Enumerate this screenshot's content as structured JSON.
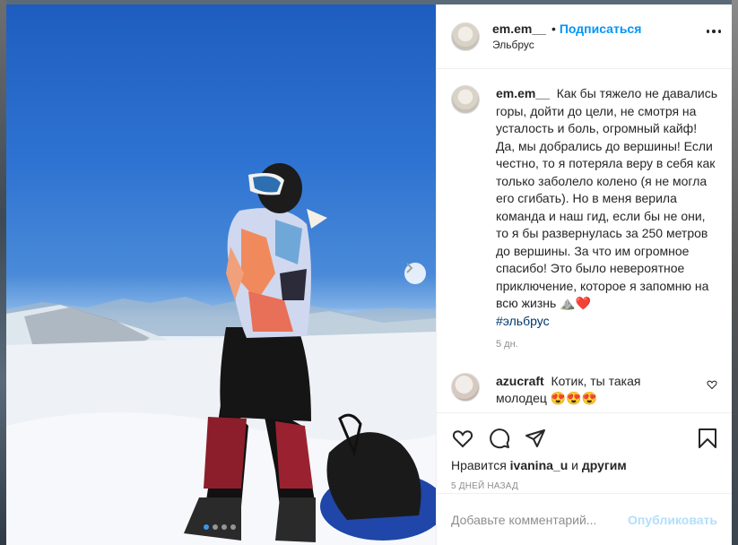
{
  "post": {
    "author": "em.em__",
    "follow_label": "Подписаться",
    "separator": "•",
    "location": "Эльбрус",
    "more_icon": "more-horizontal-icon",
    "carousel": {
      "total": 4,
      "current": 1,
      "next_icon": "chevron-right-icon"
    }
  },
  "caption": {
    "author": "em.em__",
    "text": "Как бы тяжело не давались горы, дойти до цели, не смотря на усталость и боль, огромный кайф! Да, мы добрались до вершины! Если честно, то я потеряла веру в себя как только заболело колено (я не могла его сгибать). Но в меня верила команда и наш гид, если бы не они, то я бы развернулась за 250 метров до вершины. За что им огромное спасибо! Это было невероятное приключение, которое я запомню на всю жизнь ",
    "emoji": "⛰️❤️",
    "hashtag": "#эльбрус",
    "time": "5 дн."
  },
  "comments": [
    {
      "author": "azucraft",
      "text": "Котик, ты такая молодец ",
      "emoji": "😍😍😍",
      "like_icon": "heart-outline-icon"
    }
  ],
  "actions": {
    "icons": [
      "heart-icon",
      "comment-icon",
      "share-icon",
      "bookmark-icon"
    ],
    "likes_prefix": "Нравится",
    "likes_user": "ivanina_u",
    "likes_suffix": "и",
    "likes_others": "другим",
    "date": "5 ДНЕЙ НАЗАД"
  },
  "add_comment": {
    "placeholder": "Добавьте комментарий...",
    "publish_label": "Опубликовать"
  },
  "colors": {
    "accent": "#0095f6",
    "publish_disabled": "#b2dffc",
    "hashtag": "#00376b",
    "muted": "#8e8e8e"
  }
}
